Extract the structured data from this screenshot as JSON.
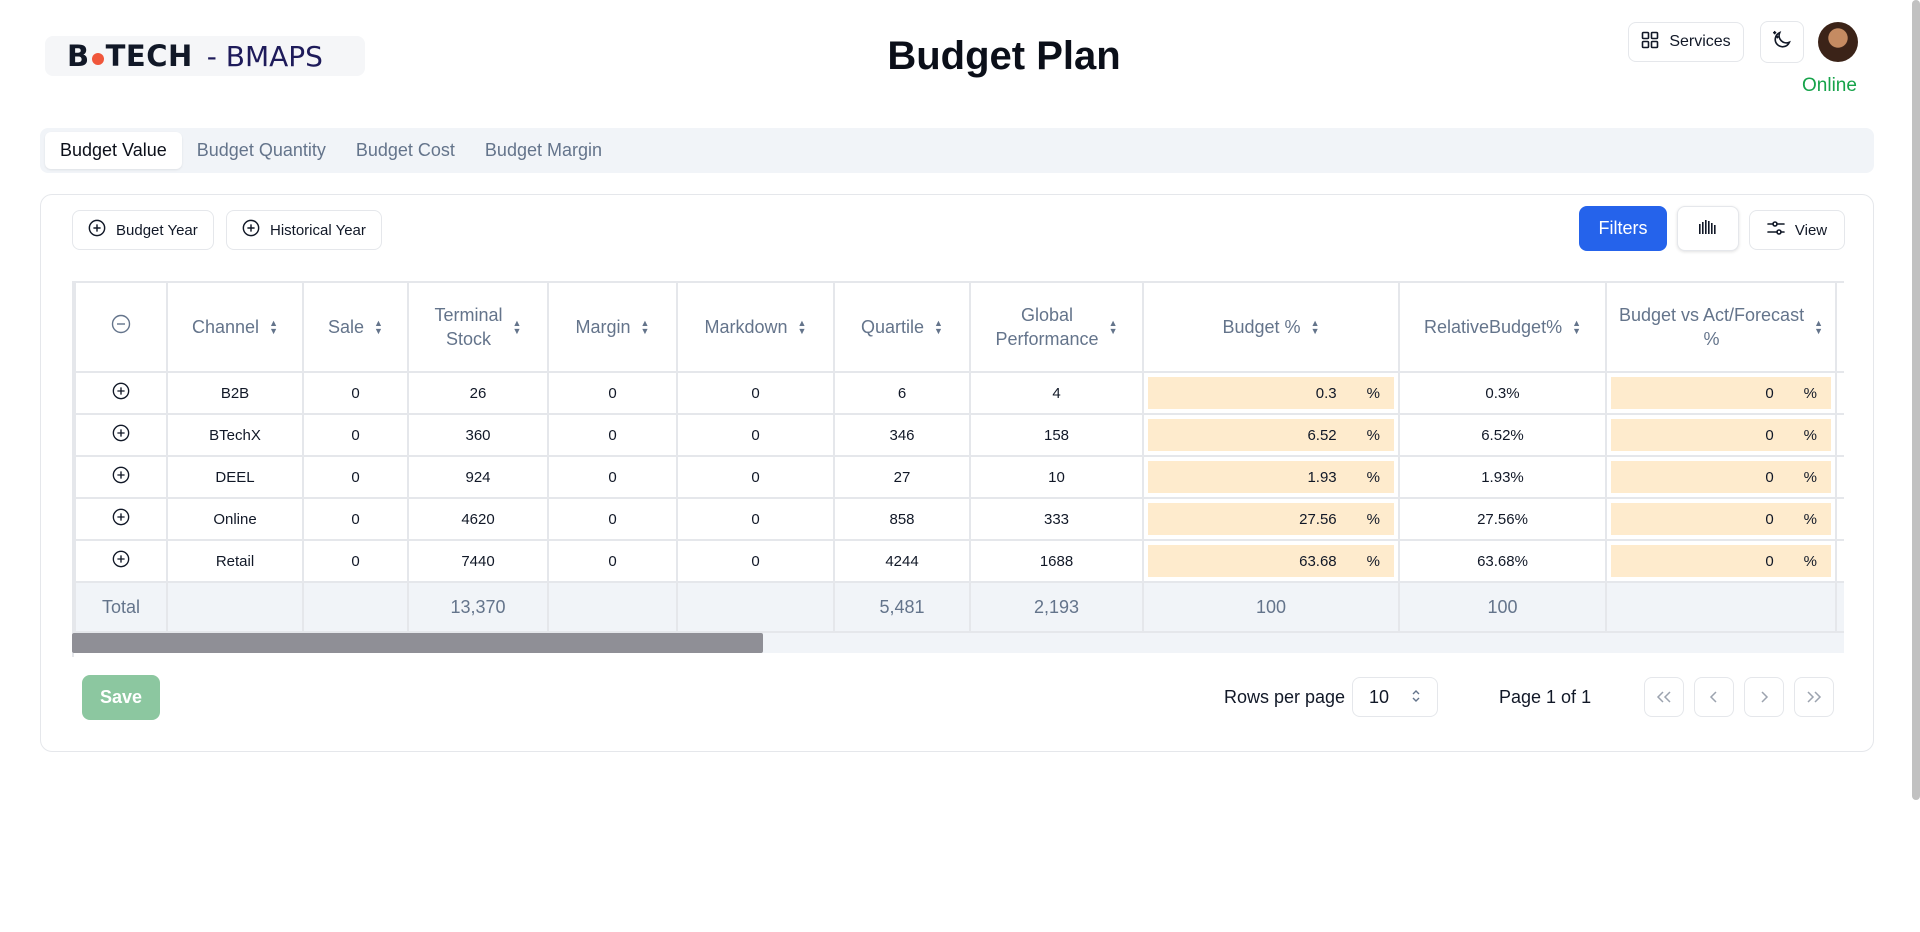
{
  "app": {
    "logo_brand_left": "B",
    "logo_brand_right": "TECH",
    "logo_sub": "- BMAPS",
    "title": "Budget Plan",
    "services_label": "Services",
    "status": "Online",
    "status_color": "#16a34a"
  },
  "tabs": [
    {
      "label": "Budget Value",
      "active": true
    },
    {
      "label": "Budget Quantity",
      "active": false
    },
    {
      "label": "Budget Cost",
      "active": false
    },
    {
      "label": "Budget Margin",
      "active": false
    }
  ],
  "toolbar": {
    "budget_year_label": "Budget Year",
    "historical_year_label": "Historical Year",
    "filters_label": "Filters",
    "view_label": "View",
    "accent_color": "#2563eb"
  },
  "table": {
    "headers": {
      "channel": "Channel",
      "sale": "Sale",
      "terminal_stock_1": "Terminal",
      "terminal_stock_2": "Stock",
      "margin": "Margin",
      "markdown": "Markdown",
      "quartile": "Quartile",
      "global_perf_1": "Global",
      "global_perf_2": "Performance",
      "budget_pct": "Budget %",
      "relative_budget": "RelativeBudget%",
      "bva_1": "Budget vs Act/Forecast",
      "bva_2": "%"
    },
    "rows": [
      {
        "channel": "B2B",
        "sale": "0",
        "terminal_stock": "26",
        "margin": "0",
        "markdown": "0",
        "quartile": "6",
        "global_performance": "4",
        "budget_pct": "0.3",
        "relative_budget": "0.3%",
        "bva": "0"
      },
      {
        "channel": "BTechX",
        "sale": "0",
        "terminal_stock": "360",
        "margin": "0",
        "markdown": "0",
        "quartile": "346",
        "global_performance": "158",
        "budget_pct": "6.52",
        "relative_budget": "6.52%",
        "bva": "0"
      },
      {
        "channel": "DEEL",
        "sale": "0",
        "terminal_stock": "924",
        "margin": "0",
        "markdown": "0",
        "quartile": "27",
        "global_performance": "10",
        "budget_pct": "1.93",
        "relative_budget": "1.93%",
        "bva": "0"
      },
      {
        "channel": "Online",
        "sale": "0",
        "terminal_stock": "4620",
        "margin": "0",
        "markdown": "0",
        "quartile": "858",
        "global_performance": "333",
        "budget_pct": "27.56",
        "relative_budget": "27.56%",
        "bva": "0"
      },
      {
        "channel": "Retail",
        "sale": "0",
        "terminal_stock": "7440",
        "margin": "0",
        "markdown": "0",
        "quartile": "4244",
        "global_performance": "1688",
        "budget_pct": "63.68",
        "relative_budget": "63.68%",
        "bva": "0"
      }
    ],
    "pct_symbol": "%",
    "total": {
      "label": "Total",
      "terminal_stock": "13,370",
      "quartile": "5,481",
      "global_performance": "2,193",
      "budget_pct": "100",
      "relative_budget": "100"
    },
    "highlight_color": "#feebcd",
    "horizontal_scroll_fraction": 0.39
  },
  "footer": {
    "save_label": "Save",
    "rows_per_page_label": "Rows per page",
    "rows_per_page_value": "10",
    "page_info": "Page 1 of 1"
  }
}
